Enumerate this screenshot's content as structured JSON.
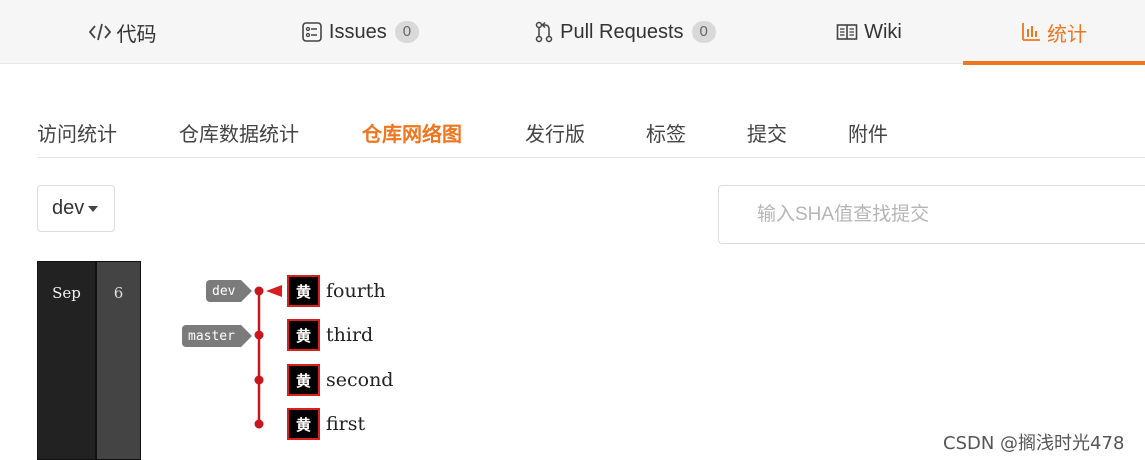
{
  "top_tabs": [
    {
      "label": "代码",
      "icon": "code-icon"
    },
    {
      "label": "Issues",
      "icon": "issues-icon",
      "count": "0"
    },
    {
      "label": "Pull Requests",
      "icon": "pull-request-icon",
      "count": "0"
    },
    {
      "label": "Wiki",
      "icon": "wiki-book-icon"
    },
    {
      "label": "统计",
      "icon": "bar-chart-icon",
      "active": true
    }
  ],
  "sub_tabs": [
    {
      "label": "访问统计"
    },
    {
      "label": "仓库数据统计"
    },
    {
      "label": "仓库网络图",
      "active": true
    },
    {
      "label": "发行版"
    },
    {
      "label": "标签"
    },
    {
      "label": "提交"
    },
    {
      "label": "附件"
    }
  ],
  "branch_select": {
    "value": "dev"
  },
  "search": {
    "placeholder": "输入SHA值查找提交",
    "value": ""
  },
  "timeline": {
    "month": "Sep",
    "day": "6"
  },
  "graph": {
    "branch_color": "#c8161d",
    "refs": [
      {
        "label": "dev",
        "commit_index": 0
      },
      {
        "label": "master",
        "commit_index": 1
      }
    ],
    "commits": [
      {
        "avatar": "黄",
        "message": "fourth",
        "head": true
      },
      {
        "avatar": "黄",
        "message": "third"
      },
      {
        "avatar": "黄",
        "message": "second"
      },
      {
        "avatar": "黄",
        "message": "first"
      }
    ]
  },
  "watermark": "CSDN @搁浅时光478",
  "colors": {
    "accent": "#f0751f",
    "tab_bar_bg": "#f6f6f6",
    "badge_bg": "#d9d9d9"
  }
}
